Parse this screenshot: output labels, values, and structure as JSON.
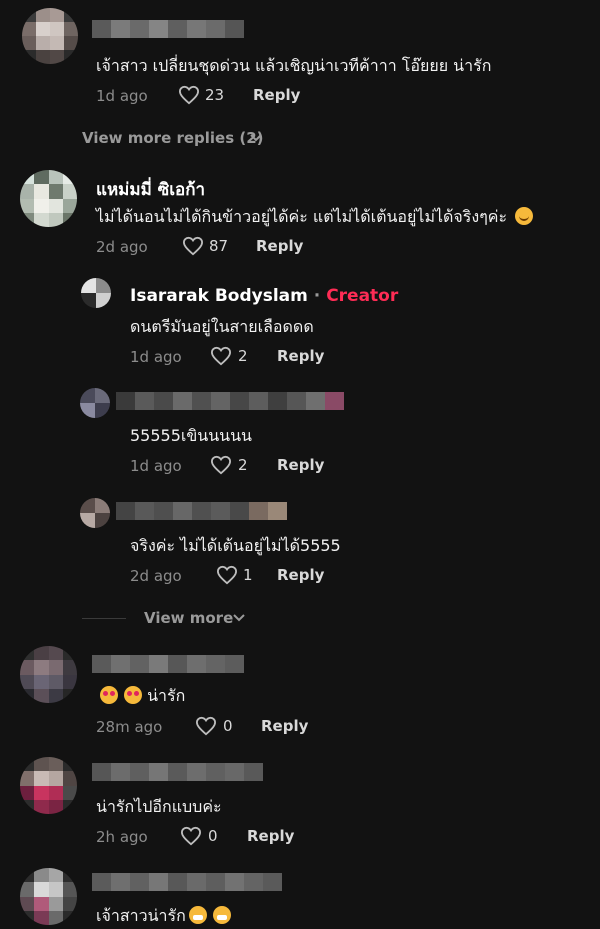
{
  "comments": [
    {
      "text": "เจ้าสาว เปลี่ยนชุดด่วน แล้วเชิญน่าเวทีค้าาา โอ๊ยยย น่ารัก",
      "time": "1d ago",
      "likes": "23",
      "reply": "Reply"
    },
    {
      "view_replies": "View more replies (2)"
    },
    {
      "name": "แหม่มมี่ ซิเอก้า",
      "text": "ไม่ได้นอนไม่ได้กินข้าวอยู่ได้ค่ะ แต่ไม่ได้เต้นอยู่ไม่ได้จริงๆค่ะ",
      "time": "2d ago",
      "likes": "87",
      "reply": "Reply",
      "emoji": "smile"
    },
    {
      "name": "Isararak Bodyslam",
      "badge_sep": "·",
      "badge": "Creator",
      "text": "ดนตรีมันอยู่ในสายเลือดดด",
      "time": "1d ago",
      "likes": "2",
      "reply": "Reply"
    },
    {
      "text": "55555เขินนนนน",
      "time": "1d ago",
      "likes": "2",
      "reply": "Reply"
    },
    {
      "text": "จริงค่ะ ไม่ได้เต้นอยู่ไม่ได้5555",
      "time": "2d ago",
      "likes": "1",
      "reply": "Reply"
    },
    {
      "view_more": "View more"
    },
    {
      "text": "น่ารัก",
      "time": "28m ago",
      "likes": "0",
      "reply": "Reply",
      "emoji": "love"
    },
    {
      "text": "น่ารักไปอีกแบบค่ะ",
      "time": "2h ago",
      "likes": "0",
      "reply": "Reply"
    },
    {
      "text": "เจ้าสาวน่ารัก",
      "emoji": "grin"
    }
  ],
  "colors": {
    "background": "#121212",
    "creator": "#fe2c55"
  }
}
